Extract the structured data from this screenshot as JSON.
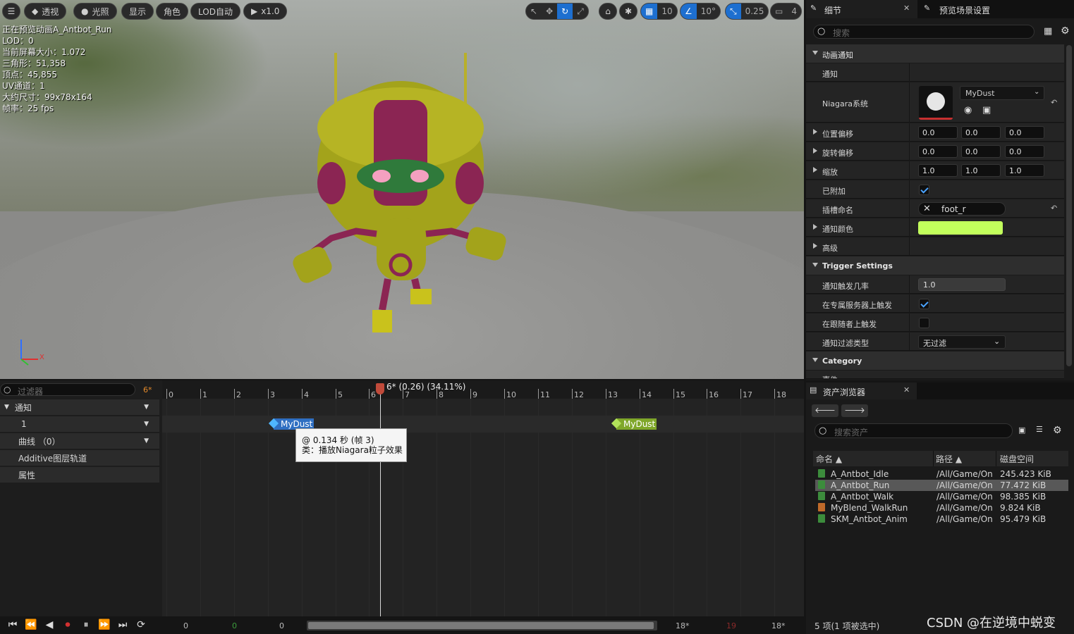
{
  "viewport": {
    "toolbar": {
      "view_mode": "透视",
      "lighting": "光照",
      "show": "显示",
      "character": "角色",
      "lod": "LOD自动",
      "play_rate": "x1.0",
      "grid_value": "10",
      "angle_value": "10°",
      "scale_value": "0.25",
      "camera_speed": "4"
    },
    "info_lines": [
      "正在预览动画A_Antbot_Run",
      "LOD：0",
      "当前屏幕大小：1.072",
      "三角形：51,358",
      "顶点：45,855",
      "UV通道：1",
      "大约尺寸：99x78x164",
      "帧率：25 fps"
    ],
    "axis_x_label": "X"
  },
  "timeline": {
    "filter_placeholder": "过滤器",
    "frame_badge": "6*",
    "tracks": {
      "notify": "通知",
      "notify_track_1": "1",
      "curves": "曲线 （0）",
      "additive": "Additive图层轨道",
      "attributes": "属性"
    },
    "ruler_numbers": [
      "0",
      "1",
      "2",
      "3",
      "4",
      "5",
      "6",
      "7",
      "8",
      "9",
      "10",
      "11",
      "12",
      "13",
      "14",
      "15",
      "16",
      "17",
      "18"
    ],
    "playhead_label": "6* (0.26) (34.11%)",
    "notifies": [
      "MyDust",
      "MyDust"
    ],
    "tooltip": {
      "line1": "@ 0.134 秒 (帧 3)",
      "line2": "类：播放Niagara粒子效果"
    },
    "footer": {
      "start_a": "0",
      "start_b": "0",
      "start_c": "0",
      "end_a": "18*",
      "end_b": "19",
      "end_c": "18*"
    }
  },
  "details": {
    "tab_details": "细节",
    "tab_preview": "预览场景设置",
    "search_placeholder": "搜索",
    "sections": {
      "anim_notify": "动画通知",
      "trigger": "Trigger Settings",
      "category": "Category",
      "event": "事件"
    },
    "props": {
      "notify": "通知",
      "niagara": "Niagara系统",
      "niagara_value": "MyDust",
      "location_offset": "位置偏移",
      "rotation_offset": "旋转偏移",
      "scale": "缩放",
      "attached": "已附加",
      "socket": "插槽命名",
      "socket_value": "foot_r",
      "notify_color": "通知颜色",
      "advanced": "高级",
      "trigger_chance": "通知触发几率",
      "trigger_chance_value": "1.0",
      "dedicated_server": "在专属服务器上触发",
      "follower": "在跟随者上触发",
      "filter_type": "通知过滤类型",
      "filter_value": "无过滤"
    },
    "vectors": {
      "location": [
        "0.0",
        "0.0",
        "0.0"
      ],
      "rotation": [
        "0.0",
        "0.0",
        "0.0"
      ],
      "scale": [
        "1.0",
        "1.0",
        "1.0"
      ]
    },
    "colors": {
      "notify_color": "#c2ff5c",
      "accent": "#1d6fd0"
    }
  },
  "assets": {
    "tab": "资产浏览器",
    "search_placeholder": "搜索资产",
    "columns": {
      "name": "命名",
      "path": "路径",
      "size": "磁盘空间"
    },
    "rows": [
      {
        "name": "A_Antbot_Idle",
        "path": "/All/Game/On",
        "size": "245.423 KiB"
      },
      {
        "name": "A_Antbot_Run",
        "path": "/All/Game/On",
        "size": "77.472 KiB"
      },
      {
        "name": "A_Antbot_Walk",
        "path": "/All/Game/On",
        "size": "98.385 KiB"
      },
      {
        "name": "MyBlend_WalkRun",
        "path": "/All/Game/On",
        "size": "9.824 KiB"
      },
      {
        "name": "SKM_Antbot_Anim",
        "path": "/All/Game/On",
        "size": "95.479 KiB"
      }
    ],
    "status": "5 项(1 项被选中)",
    "watermark": "CSDN @在逆境中蜕变"
  }
}
